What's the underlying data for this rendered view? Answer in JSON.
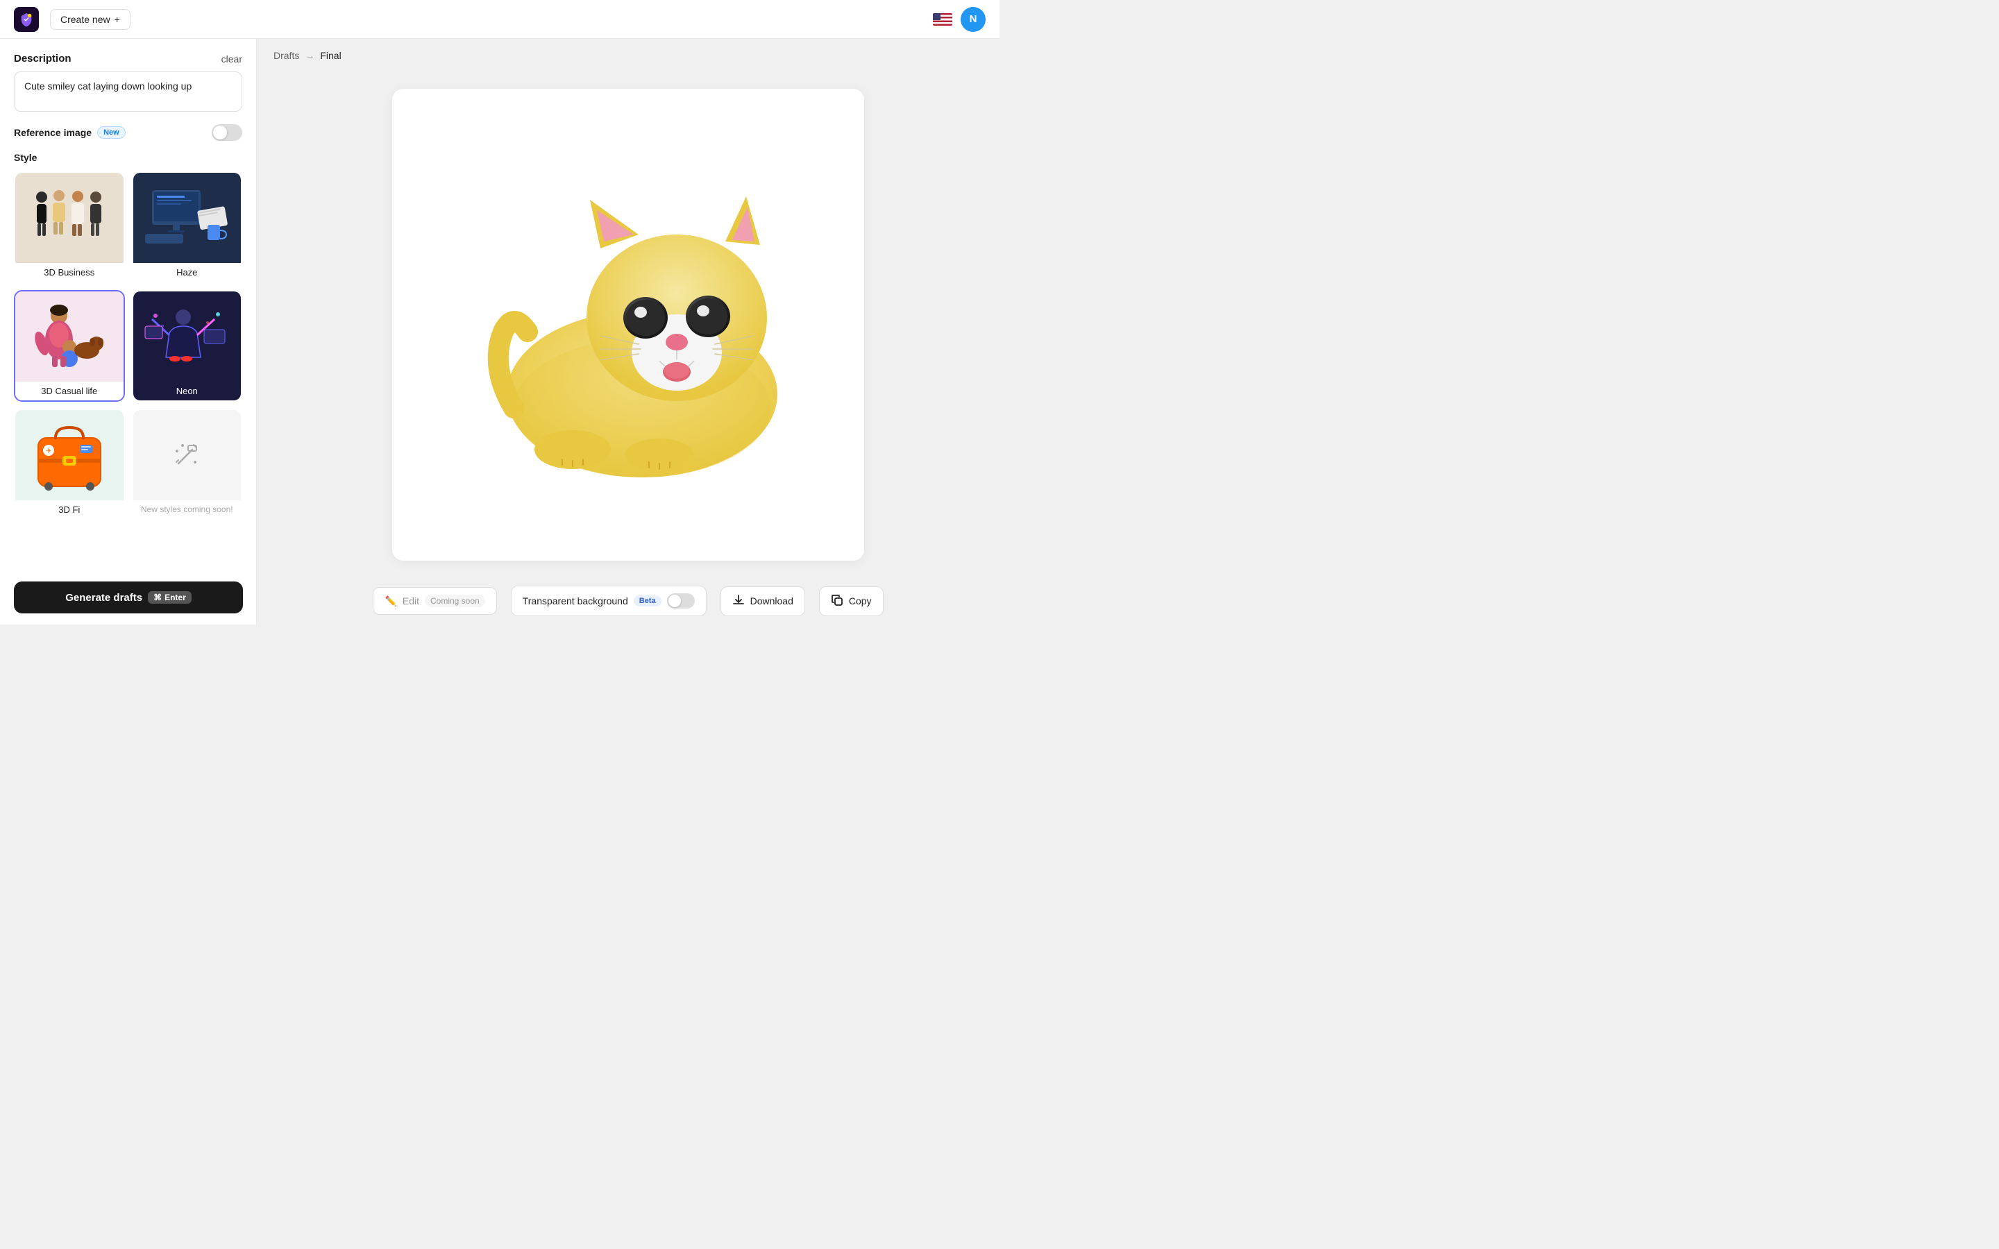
{
  "header": {
    "create_new_label": "Create new",
    "avatar_letter": "N"
  },
  "sidebar": {
    "description_section": {
      "title": "Description",
      "clear_label": "clear",
      "input_value": "Cute smiley cat laying down looking up"
    },
    "reference_image": {
      "label": "Reference image",
      "new_badge": "New"
    },
    "style_section": {
      "title": "Style",
      "cards": [
        {
          "id": "3d-business",
          "label": "3D Business",
          "selected": false
        },
        {
          "id": "haze",
          "label": "Haze",
          "selected": false
        },
        {
          "id": "3d-casual",
          "label": "3D Casual life",
          "selected": true
        },
        {
          "id": "neon",
          "label": "Neon",
          "selected": false
        },
        {
          "id": "3d-fi",
          "label": "3D Fi",
          "selected": false
        },
        {
          "id": "coming-soon",
          "label": "New styles coming soon!",
          "selected": false
        }
      ]
    },
    "generate_btn": {
      "label": "Generate drafts",
      "enter_label": "Enter"
    }
  },
  "content": {
    "breadcrumb": {
      "drafts_label": "Drafts",
      "arrow": "→",
      "final_label": "Final"
    },
    "bottom_toolbar": {
      "edit_label": "Edit",
      "coming_soon_label": "Coming soon",
      "transparent_bg_label": "Transparent background",
      "beta_label": "Beta",
      "download_label": "Download",
      "copy_label": "Copy"
    }
  }
}
